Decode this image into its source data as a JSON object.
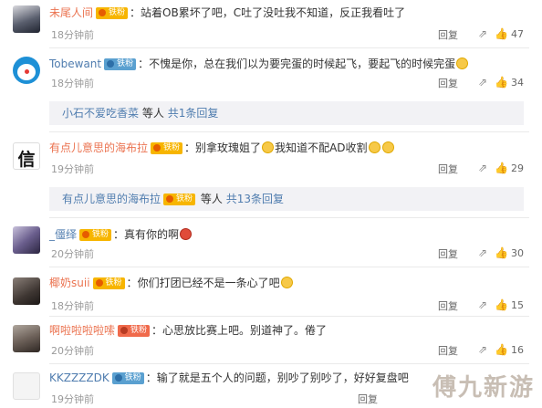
{
  "comments": [
    {
      "username": "未尾人间",
      "badge": "铁粉",
      "text": "站着OB累坏了吧，C吐了没吐我不知道，反正我看吐了",
      "time": "18分钟前",
      "reply_label": "回复",
      "likes": "47",
      "avatar_desc": "anime-girl-avatar"
    },
    {
      "username": "Tobewant",
      "badge": "铁粉",
      "text": "不愧是你，总在我们以为要完蛋的时候起飞，要起飞的时候完蛋",
      "time": "18分钟前",
      "reply_label": "回复",
      "likes": "34",
      "avatar_desc": "doraemon-avatar",
      "sub": {
        "user": "小石不爱吃香菜",
        "text": "等人",
        "link": "共1条回复"
      }
    },
    {
      "username": "有点儿意思的海布拉",
      "badge": "铁粉",
      "text": "别拿玫瑰姐了",
      "text2": "我知道不配AD收割",
      "time": "19分钟前",
      "reply_label": "回复",
      "likes": "29",
      "avatar_desc": "xin-character-avatar",
      "avatar_char": "信",
      "sub": {
        "user": "有点儿意思的海布拉",
        "text": "等人",
        "link": "共13条回复"
      }
    },
    {
      "username": "_僵绎",
      "badge": "铁粉",
      "text": "真有你的啊",
      "time": "20分钟前",
      "reply_label": "回复",
      "likes": "30",
      "avatar_desc": "anime-avatar"
    },
    {
      "username": "椰奶suii",
      "badge": "铁粉",
      "text": "你们打团已经不是一条心了吧",
      "time": "18分钟前",
      "reply_label": "回复",
      "likes": "15",
      "avatar_desc": "photo-avatar"
    },
    {
      "username": "啊啦啦啦啦嗦",
      "badge": "铁粉",
      "text": "心思放比赛上吧。别道神了。倦了",
      "time": "20分钟前",
      "reply_label": "回复",
      "likes": "16",
      "avatar_desc": "photo-avatar"
    },
    {
      "username": "KKZZZZDK",
      "badge": "铁粉",
      "text": "输了就是五个人的问题，别吵了别吵了，好好复盘吧",
      "time": "19分钟前",
      "reply_label": "回复",
      "likes": "",
      "avatar_desc": "blank-avatar"
    }
  ],
  "watermark": "傅九新游",
  "colors": {
    "username": "#eb7350",
    "link": "#507daf",
    "meta": "#9a9a9a",
    "subbox_bg": "#f2f2f5",
    "badge": "#f7b500"
  }
}
